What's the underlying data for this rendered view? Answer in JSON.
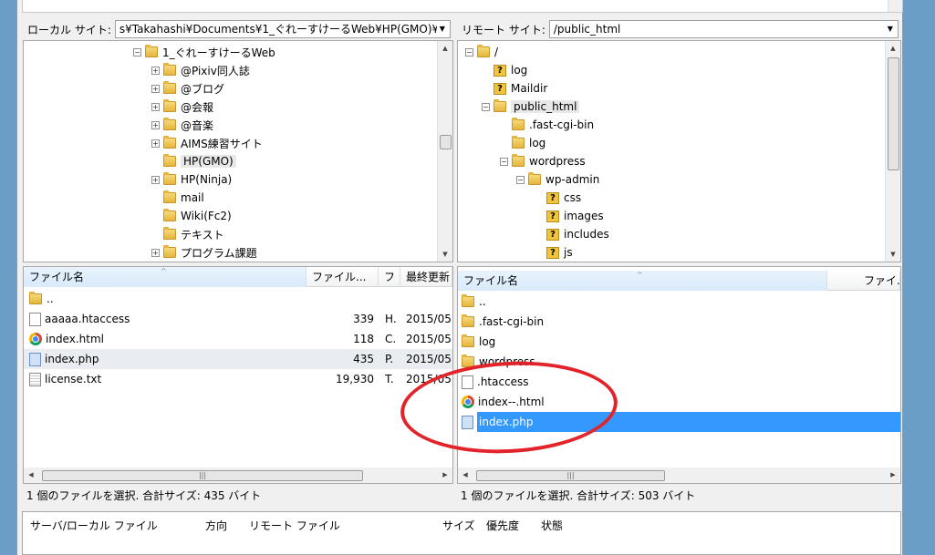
{
  "local": {
    "site_label": "ローカル サイト:",
    "site_path": "s¥Takahashi¥Documents¥1_ぐれーすけーるWeb¥HP(GMO)¥",
    "tree": [
      {
        "label": "1_ぐれーすけーるWeb",
        "expander": "minus",
        "selected": false
      },
      {
        "label": "@Pixiv同人誌",
        "expander": "plus",
        "selected": false
      },
      {
        "label": "@ブログ",
        "expander": "plus",
        "selected": false
      },
      {
        "label": "@会報",
        "expander": "plus",
        "selected": false
      },
      {
        "label": "@音楽",
        "expander": "plus",
        "selected": false
      },
      {
        "label": "AIMS練習サイト",
        "expander": "plus",
        "selected": false
      },
      {
        "label": "HP(GMO)",
        "expander": "none",
        "selected": true
      },
      {
        "label": "HP(Ninja)",
        "expander": "plus",
        "selected": false
      },
      {
        "label": "mail",
        "expander": "none",
        "selected": false
      },
      {
        "label": "Wiki(Fc2)",
        "expander": "none",
        "selected": false
      },
      {
        "label": "テキスト",
        "expander": "none",
        "selected": false
      },
      {
        "label": "プログラム課題",
        "expander": "plus",
        "selected": false
      }
    ],
    "columns": [
      "ファイル名",
      "ファイル...",
      "フ",
      "最終更新"
    ],
    "files": [
      {
        "name": "..",
        "icon": "folder-icon",
        "size": "",
        "type": "",
        "modified": ""
      },
      {
        "name": "aaaaa.htaccess",
        "icon": "file-icon",
        "size": "339",
        "type": "H.",
        "modified": "2015/05/"
      },
      {
        "name": "index.html",
        "icon": "chrome-icon",
        "size": "118",
        "type": "C.",
        "modified": "2015/05/"
      },
      {
        "name": "index.php",
        "icon": "php-file-icon",
        "size": "435",
        "type": "P.",
        "modified": "2015/05/"
      },
      {
        "name": "license.txt",
        "icon": "text-file-icon",
        "size": "19,930",
        "type": "T.",
        "modified": "2015/05/"
      }
    ],
    "status": "1 個のファイルを選択. 合計サイズ: 435 バイト"
  },
  "remote": {
    "site_label": "リモート サイト:",
    "site_path": "/public_html",
    "tree": [
      {
        "label": "/",
        "kind": "folder",
        "expander": "minus"
      },
      {
        "label": "log",
        "kind": "unknown",
        "expander": "none"
      },
      {
        "label": "Maildir",
        "kind": "unknown",
        "expander": "none"
      },
      {
        "label": "public_html",
        "kind": "folder",
        "expander": "minus",
        "selected": true
      },
      {
        "label": ".fast-cgi-bin",
        "kind": "folder",
        "expander": "none"
      },
      {
        "label": "log",
        "kind": "folder",
        "expander": "none"
      },
      {
        "label": "wordpress",
        "kind": "folder",
        "expander": "minus"
      },
      {
        "label": "wp-admin",
        "kind": "folder",
        "expander": "minus"
      },
      {
        "label": "css",
        "kind": "unknown",
        "expander": "none"
      },
      {
        "label": "images",
        "kind": "unknown",
        "expander": "none"
      },
      {
        "label": "includes",
        "kind": "unknown",
        "expander": "none"
      },
      {
        "label": "js",
        "kind": "unknown",
        "expander": "none"
      }
    ],
    "columns": [
      "ファイル名",
      "ファイ."
    ],
    "files": [
      {
        "name": "..",
        "icon": "folder-icon"
      },
      {
        "name": ".fast-cgi-bin",
        "icon": "folder-icon"
      },
      {
        "name": "log",
        "icon": "folder-icon"
      },
      {
        "name": "wordpress",
        "icon": "folder-icon"
      },
      {
        "name": ".htaccess",
        "icon": "file-icon"
      },
      {
        "name": "index--.html",
        "icon": "chrome-icon"
      },
      {
        "name": "index.php",
        "icon": "php-file-icon",
        "selected": true
      }
    ],
    "status": "1 個のファイルを選択. 合計サイズ: 503 バイト"
  },
  "queue": {
    "columns": [
      "サーバ/ローカル ファイル",
      "方向",
      "リモート ファイル",
      "サイズ",
      "優先度",
      "状態"
    ]
  },
  "colors": {
    "selection": "#3399ff",
    "annotation_circle": "#e2232a"
  }
}
